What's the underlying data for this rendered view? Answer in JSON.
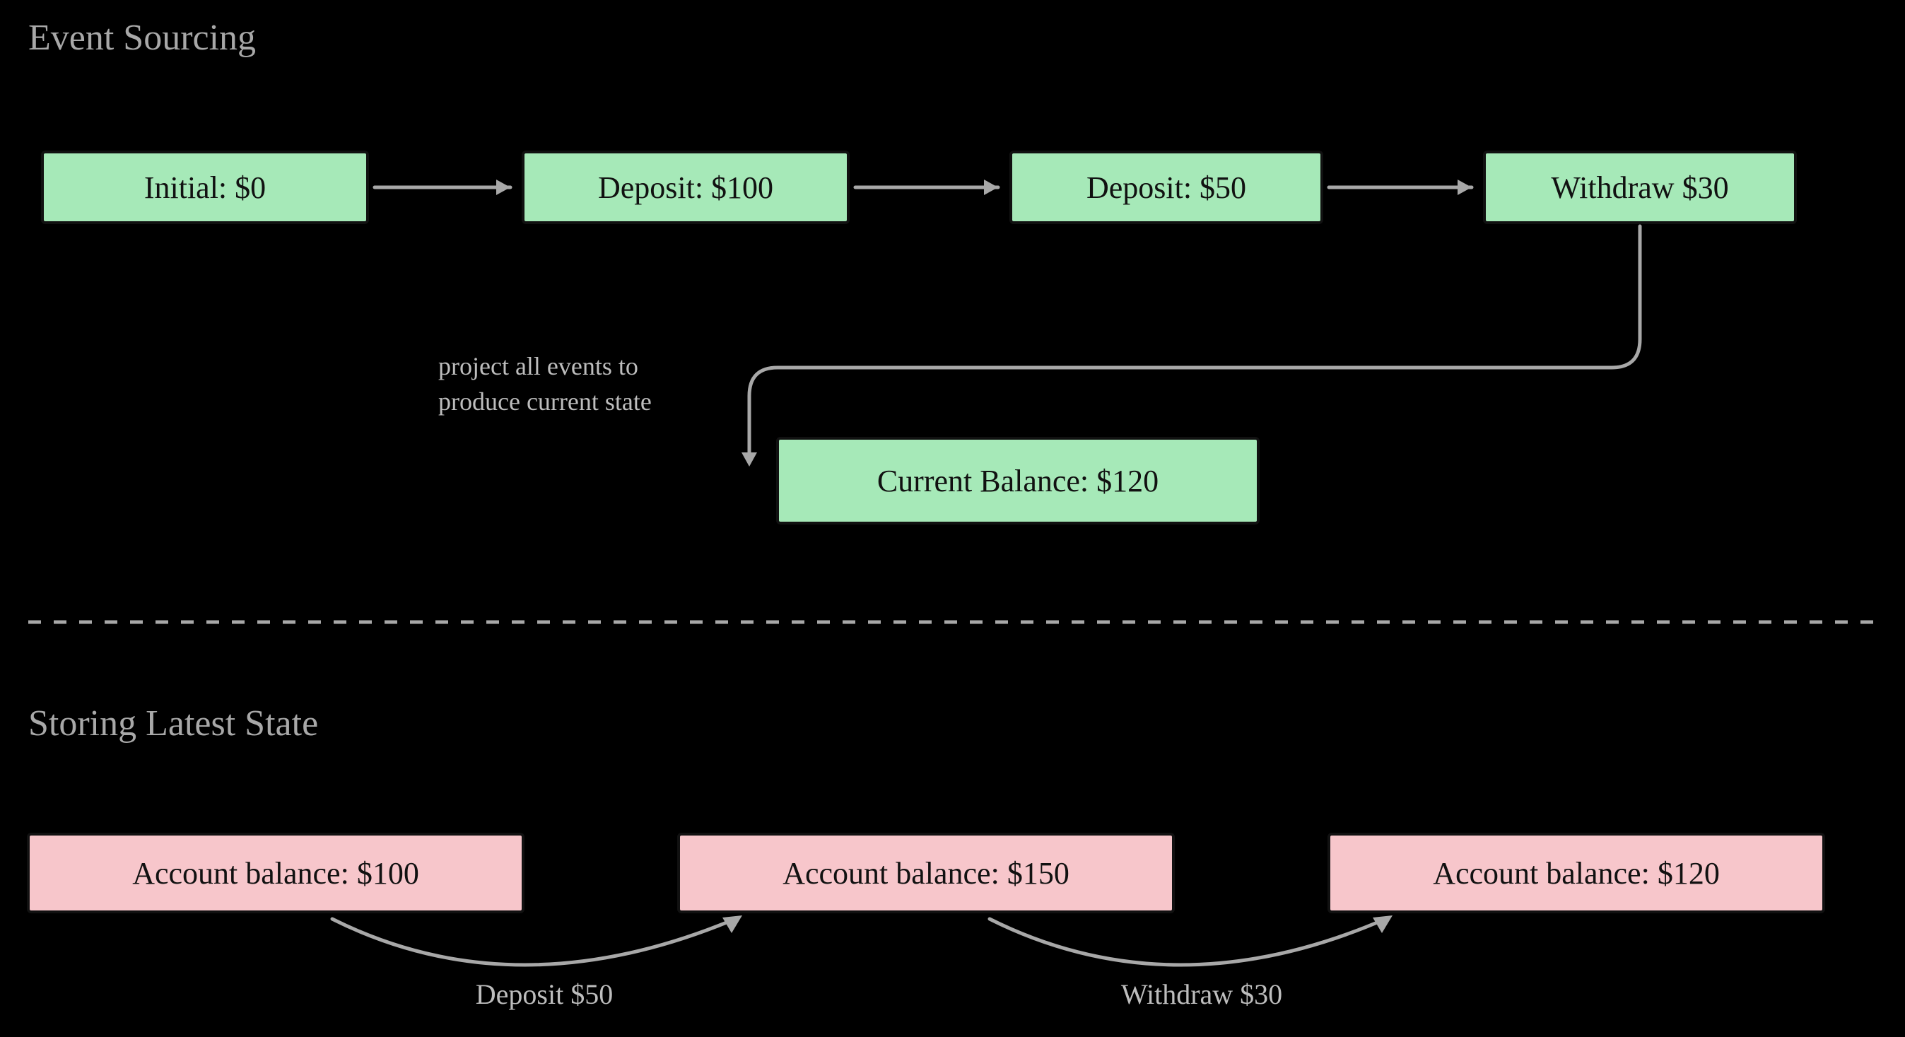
{
  "sections": {
    "top_title": "Event Sourcing",
    "bottom_title": "Storing Latest State"
  },
  "events": {
    "e1": "Initial: $0",
    "e2": "Deposit: $100",
    "e3": "Deposit: $50",
    "e4": "Withdraw $30",
    "projection_note_l1": "project all events to",
    "projection_note_l2": "produce current state",
    "result": "Current Balance: $120"
  },
  "states": {
    "s1": "Account balance: $100",
    "s2": "Account balance: $150",
    "s3": "Account balance: $120",
    "t1": "Deposit $50",
    "t2": "Withdraw $30"
  },
  "colors": {
    "green": "#a6e9b8",
    "pink": "#f7c6cb",
    "bg": "#000000",
    "line": "#a8a8a8"
  }
}
